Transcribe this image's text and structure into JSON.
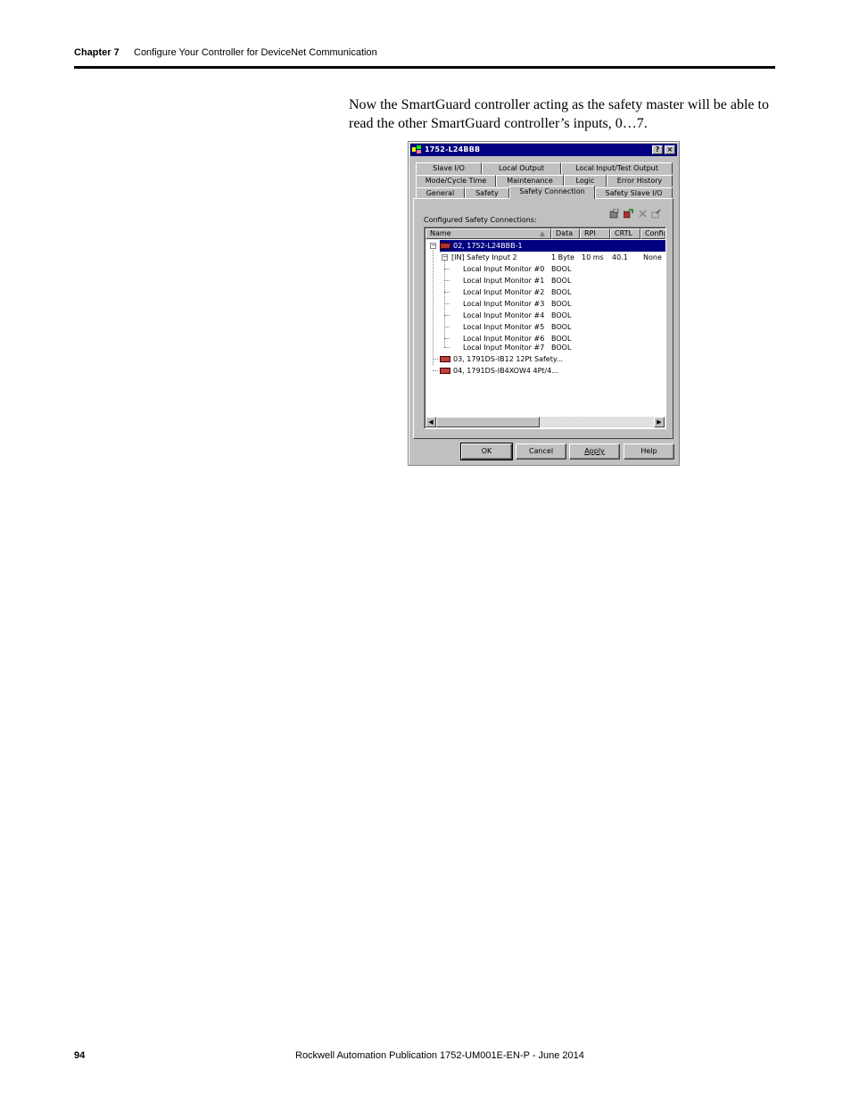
{
  "header": {
    "chapter": "Chapter 7",
    "title": "Configure Your Controller for DeviceNet Communication"
  },
  "body_text": "Now the SmartGuard controller acting as the safety master will be able to read the other SmartGuard controller’s inputs, 0…7.",
  "dialog": {
    "title": "1752-L24BBB",
    "help_btn": "?",
    "close_btn": "×",
    "tabs_row1": [
      "Slave I/O",
      "Local Output",
      "Local Input/Test Output"
    ],
    "tabs_row2": [
      "Mode/Cycle Time",
      "Maintenance",
      "Logic",
      "Error History"
    ],
    "tabs_row3": [
      "General",
      "Safety",
      "Safety Connection",
      "Safety Slave I/O"
    ],
    "active_tab": "Safety Connection",
    "configured_label": "Configured Safety Connections:",
    "toolbar_icons": [
      "add-connection-icon",
      "edit-connection-icon",
      "delete-connection-icon",
      "properties-icon"
    ],
    "columns": [
      "Name",
      "Data",
      "RPI",
      "CRTL",
      "Config"
    ],
    "tree": [
      {
        "name": "02, 1752-L24BBB-1",
        "data": "",
        "rpi": "",
        "crtl": "",
        "config": "",
        "selected": true
      },
      {
        "name": "[IN] Safety Input 2",
        "data": "1 Byte",
        "rpi": "10 ms",
        "crtl": "40.1",
        "config": "None"
      },
      {
        "name": "Local Input Monitor #0",
        "data": "BOOL"
      },
      {
        "name": "Local Input Monitor #1",
        "data": "BOOL"
      },
      {
        "name": "Local Input Monitor #2",
        "data": "BOOL"
      },
      {
        "name": "Local Input Monitor #3",
        "data": "BOOL"
      },
      {
        "name": "Local Input Monitor #4",
        "data": "BOOL"
      },
      {
        "name": "Local Input Monitor #5",
        "data": "BOOL"
      },
      {
        "name": "Local Input Monitor #6",
        "data": "BOOL"
      },
      {
        "name": "Local Input Monitor #7",
        "data": "BOOL"
      },
      {
        "name": "03, 1791DS-IB12 12Pt Safety..."
      },
      {
        "name": "04, 1791DS-IB4XOW4 4Pt/4..."
      }
    ],
    "buttons": {
      "ok": "OK",
      "cancel": "Cancel",
      "apply": "Apply",
      "help": "Help"
    }
  },
  "footer": {
    "page_number": "94",
    "publication": "Rockwell Automation Publication 1752-UM001E-EN-P - June 2014"
  }
}
